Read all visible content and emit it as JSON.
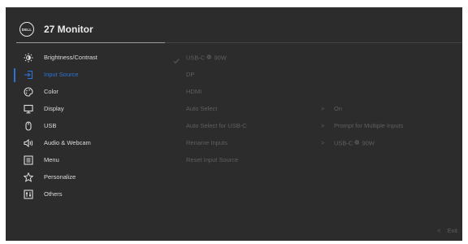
{
  "header": {
    "logo_text": "DELL",
    "title": "27 Monitor"
  },
  "menu": {
    "items": [
      {
        "label": "Brightness/Contrast",
        "icon": "brightness-icon",
        "active": false
      },
      {
        "label": "Input Source",
        "icon": "input-source-icon",
        "active": true
      },
      {
        "label": "Color",
        "icon": "color-palette-icon",
        "active": false
      },
      {
        "label": "Display",
        "icon": "display-icon",
        "active": false
      },
      {
        "label": "USB",
        "icon": "usb-mouse-icon",
        "active": false
      },
      {
        "label": "Audio & Webcam",
        "icon": "audio-webcam-icon",
        "active": false
      },
      {
        "label": "Menu",
        "icon": "menu-icon",
        "active": false
      },
      {
        "label": "Personalize",
        "icon": "star-icon",
        "active": false
      },
      {
        "label": "Others",
        "icon": "others-icon",
        "active": false
      }
    ]
  },
  "options": {
    "items": [
      {
        "label": "USB-C",
        "power": "90W",
        "selected": true
      },
      {
        "label": "DP"
      },
      {
        "label": "HDMI"
      },
      {
        "label": "Auto Select",
        "value": "On"
      },
      {
        "label": "Auto Select for USB-C",
        "value": "Prompt for Multiple Inputs"
      },
      {
        "label": "Rename Inputs",
        "value": "USB-C",
        "value_power": "90W"
      },
      {
        "label": "Reset Input Source"
      }
    ]
  },
  "footer": {
    "exit_label": "Exit"
  },
  "colors": {
    "background": "#2c2c2c",
    "accent": "#2d73d6",
    "text": "#dddddd",
    "dim_text": "#5f5f5f"
  }
}
